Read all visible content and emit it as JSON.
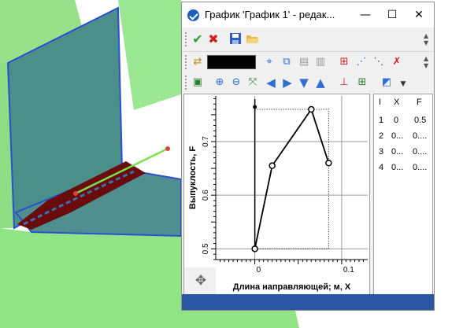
{
  "window": {
    "title": "График 'График 1' - редак...",
    "minimize_glyph": "—",
    "maximize_glyph": "☐",
    "close_glyph": "✕"
  },
  "toolbar1": {
    "icons": [
      "checkmark-icon",
      "cancel-icon",
      "save-icon",
      "open-folder-icon"
    ]
  },
  "toolbar2": {
    "color_swatch": "#000000",
    "icons": [
      "swap-icon",
      "color-swatch",
      "select-points-icon",
      "copy-icon",
      "paste-icon",
      "clipboard-icon",
      "add-point-icon",
      "insert-point-icon",
      "remove-point-icon",
      "delete-icon"
    ]
  },
  "toolbar3": {
    "icons": [
      "fit-view-icon",
      "zoom-in-icon",
      "zoom-out-icon",
      "zoom-fit-icon",
      "arrow-left-icon",
      "arrow-right-icon",
      "arrow-down-icon",
      "arrow-up-icon",
      "axis-settings-icon",
      "grid-icon",
      "view-options-icon",
      "dropdown-arrow-icon"
    ]
  },
  "colors": {
    "title_icon": "#1f5fbf",
    "checkmark": "#2e9e2e",
    "cancel": "#d21f1f",
    "arrows": "#2f6fd1",
    "statusbar": "#2b56a4",
    "plot_line": "#000000"
  },
  "chart_data": {
    "type": "line",
    "xlabel": "Длина направляющей; м, X",
    "ylabel": "Выпуклость, F",
    "xlim": [
      -0.045,
      0.13
    ],
    "ylim": [
      0.48,
      0.785
    ],
    "x_ticks": [
      0,
      0.1
    ],
    "x_tick_labels": [
      "0",
      "0.1"
    ],
    "y_ticks": [
      0.5,
      0.6,
      0.7
    ],
    "y_tick_labels": [
      "0.5",
      "0.6",
      "0.7"
    ],
    "grid": true,
    "series": [
      {
        "x": [
          0,
          0.02,
          0.065,
          0.085
        ],
        "y": [
          0.5,
          0.655,
          0.76,
          0.66
        ]
      }
    ]
  },
  "table": {
    "headers": [
      "I",
      "X",
      "F"
    ],
    "rows": [
      [
        "1",
        "0",
        "0.5"
      ],
      [
        "2",
        "0...",
        "0...."
      ],
      [
        "3",
        "0...",
        "0...."
      ],
      [
        "4",
        "0...",
        "0...."
      ]
    ]
  },
  "pan_icon": "✥"
}
